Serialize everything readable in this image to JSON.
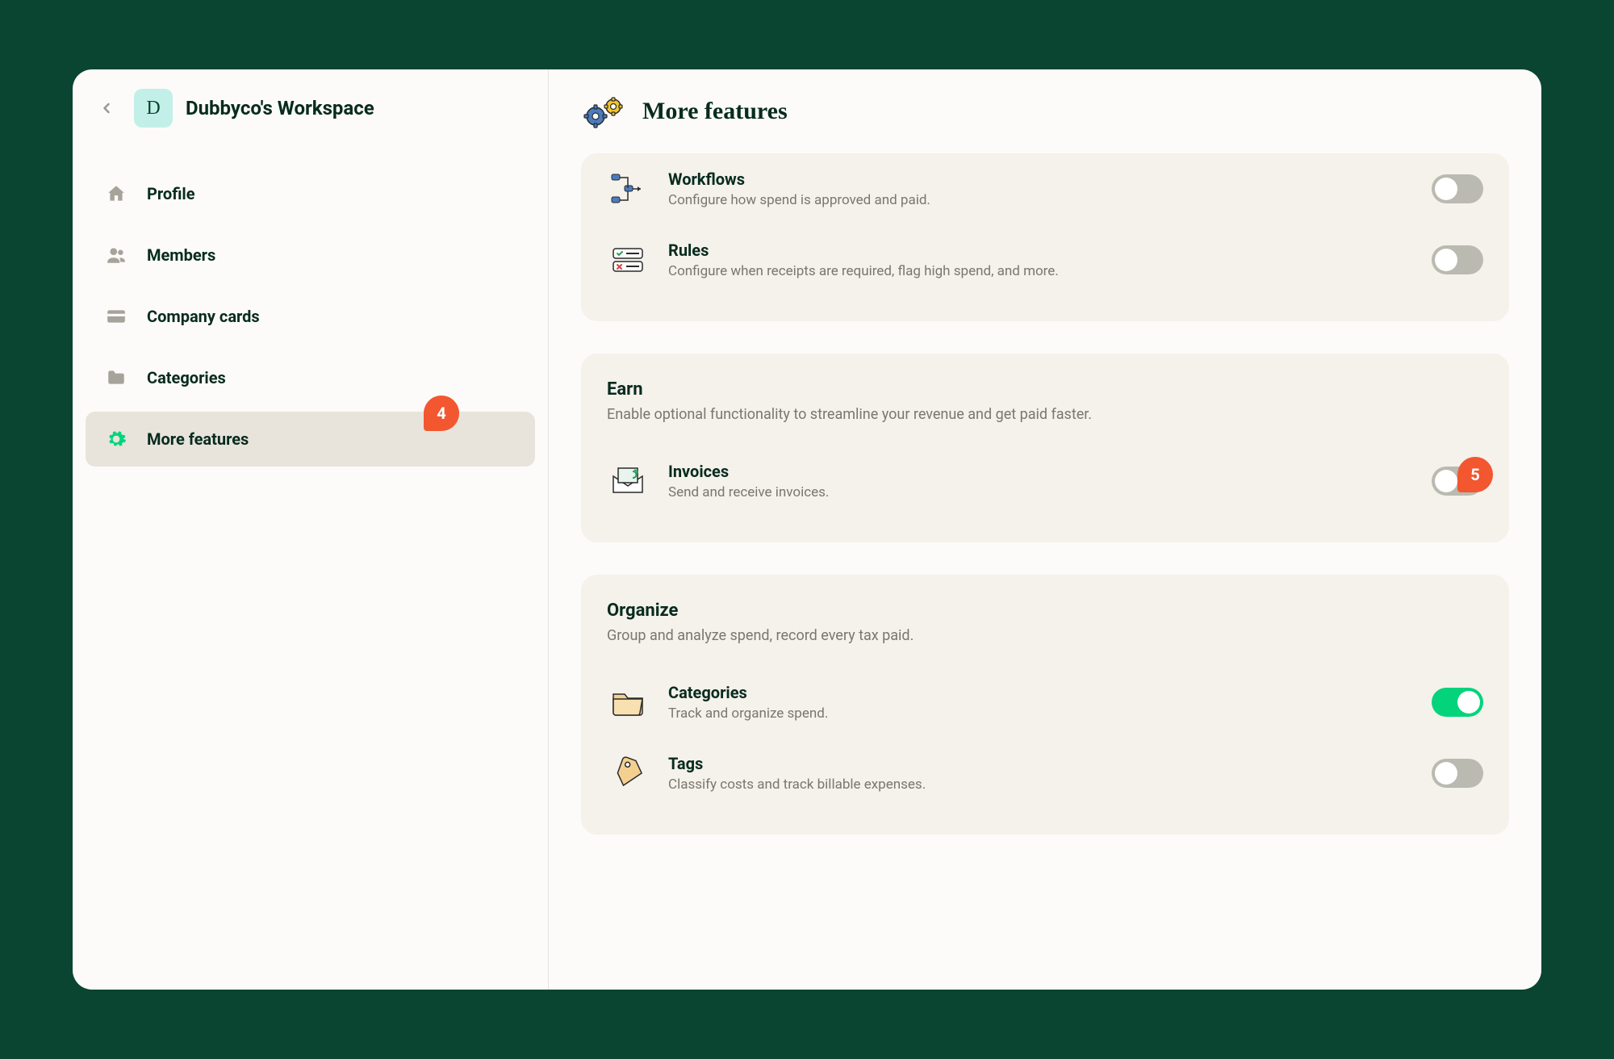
{
  "workspace": {
    "avatar_letter": "D",
    "title": "Dubbyco's Workspace"
  },
  "sidebar": {
    "items": [
      {
        "label": "Profile"
      },
      {
        "label": "Members"
      },
      {
        "label": "Company cards"
      },
      {
        "label": "Categories"
      },
      {
        "label": "More features"
      }
    ]
  },
  "header": {
    "title": "More features"
  },
  "annotations": {
    "badge4": "4",
    "badge5": "5"
  },
  "sections": {
    "spend_partial": {
      "features": [
        {
          "title": "Workflows",
          "desc": "Configure how spend is approved and paid.",
          "on": false
        },
        {
          "title": "Rules",
          "desc": "Configure when receipts are required, flag high spend, and more.",
          "on": false
        }
      ]
    },
    "earn": {
      "title": "Earn",
      "desc": "Enable optional functionality to streamline your revenue and get paid faster.",
      "features": [
        {
          "title": "Invoices",
          "desc": "Send and receive invoices.",
          "on": false
        }
      ]
    },
    "organize": {
      "title": "Organize",
      "desc": "Group and analyze spend, record every tax paid.",
      "features": [
        {
          "title": "Categories",
          "desc": "Track and organize spend.",
          "on": true
        },
        {
          "title": "Tags",
          "desc": "Classify costs and track billable expenses.",
          "on": false
        }
      ]
    }
  }
}
